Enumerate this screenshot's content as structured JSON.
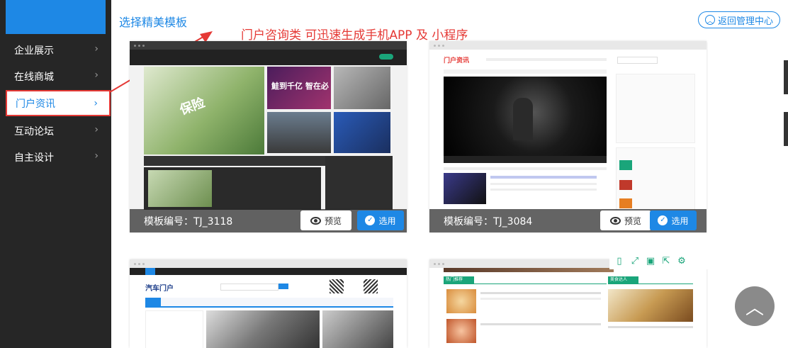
{
  "header": {
    "title": "选择精美模板",
    "annotation": "门户咨询类 可迅速生成手机APP 及 小程序",
    "back_label": "返回管理中心"
  },
  "sidebar": {
    "items": [
      {
        "label": "企业展示"
      },
      {
        "label": "在线商城"
      },
      {
        "label": "门户资讯",
        "active": true
      },
      {
        "label": "互动论坛"
      },
      {
        "label": "自主设计"
      }
    ]
  },
  "templates": [
    {
      "code": "模板编号：TJ_3118",
      "preview": "预览",
      "use": "选用"
    },
    {
      "code": "模板编号：TJ_3084",
      "preview": "预览",
      "use": "选用"
    },
    {
      "code": "",
      "preview": "",
      "use": ""
    },
    {
      "code": "",
      "preview": "",
      "use": ""
    }
  ],
  "thumbnails": {
    "t1_banner": "保险",
    "t1_promo": "鮭到千亿 智在必",
    "t2_logo": "门户资讯",
    "t3_logo": "汽车门户",
    "t4_section1": "热门推荐",
    "t4_section2": "美食达人"
  },
  "colors": {
    "accent": "#1e88e5",
    "annotation": "#e53935",
    "sidebar_bg": "#262626"
  }
}
